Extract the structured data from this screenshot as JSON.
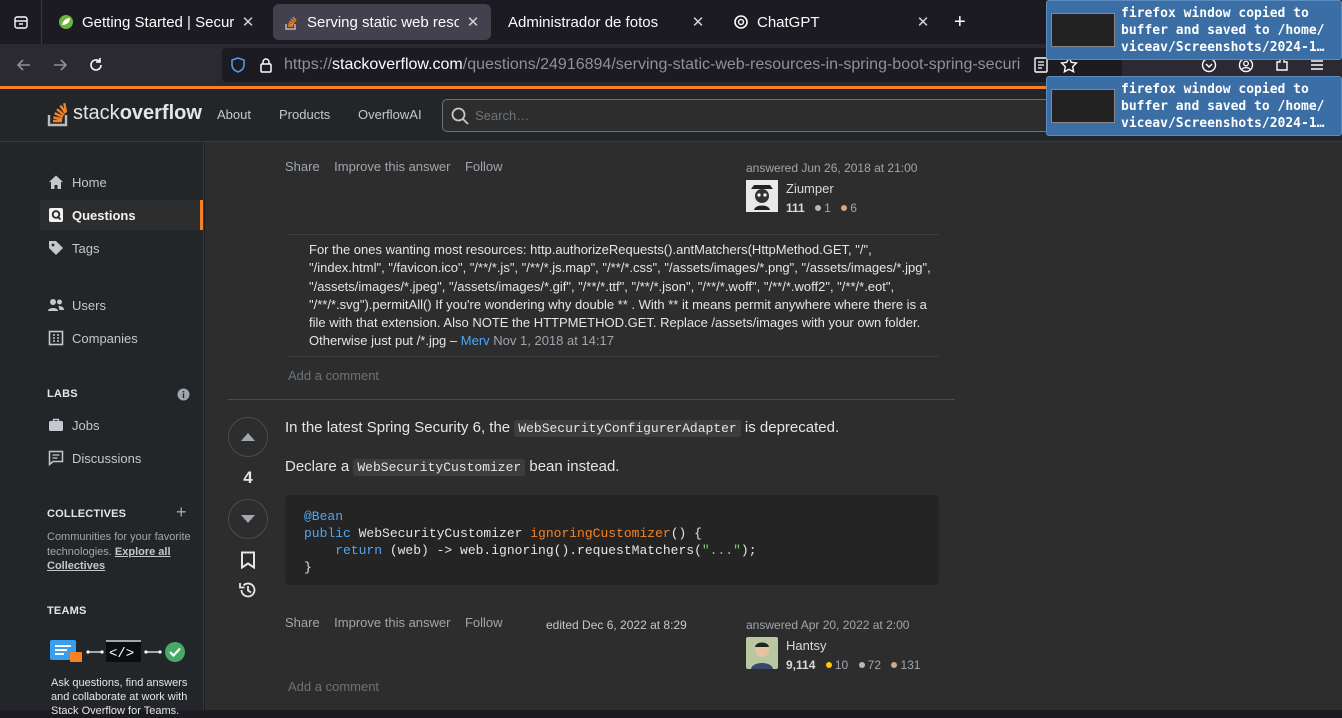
{
  "browser": {
    "tabs": [
      {
        "title": "Getting Started | Securing",
        "close": "✕"
      },
      {
        "title": "Serving static web resourc",
        "close": "✕"
      },
      {
        "title": "Administrador de fotos",
        "close": "✕"
      },
      {
        "title": "ChatGPT",
        "close": "✕"
      }
    ],
    "new_tab": "+",
    "url_domain": "stackoverflow.com",
    "url_prefix": "https://",
    "url_path": "/questions/24916894/serving-static-web-resources-in-spring-boot-spring-securi"
  },
  "notifications": [
    {
      "text": "firefox window copied to\nbuffer and saved to /home/\nviceav/Screenshots/2024-1…"
    },
    {
      "text": "firefox window copied to\nbuffer and saved to /home/\nviceav/Screenshots/2024-1…"
    }
  ],
  "header": {
    "logo_stack": "stack",
    "logo_overflow": "overflow",
    "nav": [
      "About",
      "Products",
      "OverflowAI"
    ],
    "search_placeholder": "Search…"
  },
  "sidebar": {
    "items": [
      "Home",
      "Questions",
      "Tags",
      "Users",
      "Companies"
    ],
    "labs_title": "LABS",
    "labs_items": [
      "Jobs",
      "Discussions"
    ],
    "collectives_title": "COLLECTIVES",
    "collectives_text": "Communities for your favorite technologies.",
    "collectives_link": "Explore all Collectives",
    "teams_title": "TEAMS",
    "teams_text": "Ask questions, find answers and collaborate at work with Stack Overflow for Teams."
  },
  "answer1": {
    "actions": [
      "Share",
      "Improve this answer",
      "Follow"
    ],
    "answered": "answered Jun 26, 2018 at 21:00",
    "user": "Ziumper",
    "rep": "111",
    "silver": "1",
    "bronze": "6",
    "comment": "For the ones wanting most resources: http.authorizeRequests().antMatchers(HttpMethod.GET, \"/\", \"/index.html\", \"/favicon.ico\", \"/**/*.js\", \"/**/*.js.map\", \"/**/*.css\", \"/assets/images/*.png\", \"/assets/images/*.jpg\", \"/assets/images/*.jpeg\", \"/assets/images/*.gif\", \"/**/*.ttf\", \"/**/*.json\", \"/**/*.woff\", \"/**/*.woff2\", \"/**/*.eot\", \"/**/*.svg\").permitAll() If you're wondering why double ** . With ** it means permit anywhere where there is a file with that extension. Also NOTE the HTTPMETHOD.GET. Replace /assets/images with your own folder. Otherwise just put /*.jpg –",
    "comment_author": "Merv",
    "comment_date": "Nov 1, 2018 at 14:17",
    "add_comment": "Add a comment"
  },
  "answer2": {
    "score": "4",
    "p1_a": "In the latest Spring Security 6, the",
    "p1_code": "WebSecurityConfigurerAdapter",
    "p1_b": "is deprecated.",
    "p2_a": "Declare a",
    "p2_code": "WebSecurityCustomizer",
    "p2_b": "bean instead.",
    "code": {
      "l1": "@Bean",
      "l2_kw": "public",
      "l2_type": " WebSecurityCustomizer ",
      "l2_fn": "ignoringCustomizer",
      "l2_rest": "() {",
      "l3_kw": "    return",
      "l3_mid": " (web) -> web.ignoring().requestMatchers(",
      "l3_str": "\"...\"",
      "l3_end": ");",
      "l4": "}"
    },
    "actions": [
      "Share",
      "Improve this answer",
      "Follow"
    ],
    "edited": "edited Dec 6, 2022 at 8:29",
    "answered": "answered Apr 20, 2022 at 2:00",
    "user": "Hantsy",
    "rep": "9,114",
    "gold": "10",
    "silver": "72",
    "bronze": "131",
    "add_comment": "Add a comment"
  },
  "colors": {
    "accent": "#f48225",
    "gold": "#ffcc01",
    "silver": "#b4b8bc",
    "bronze": "#d1a684"
  }
}
